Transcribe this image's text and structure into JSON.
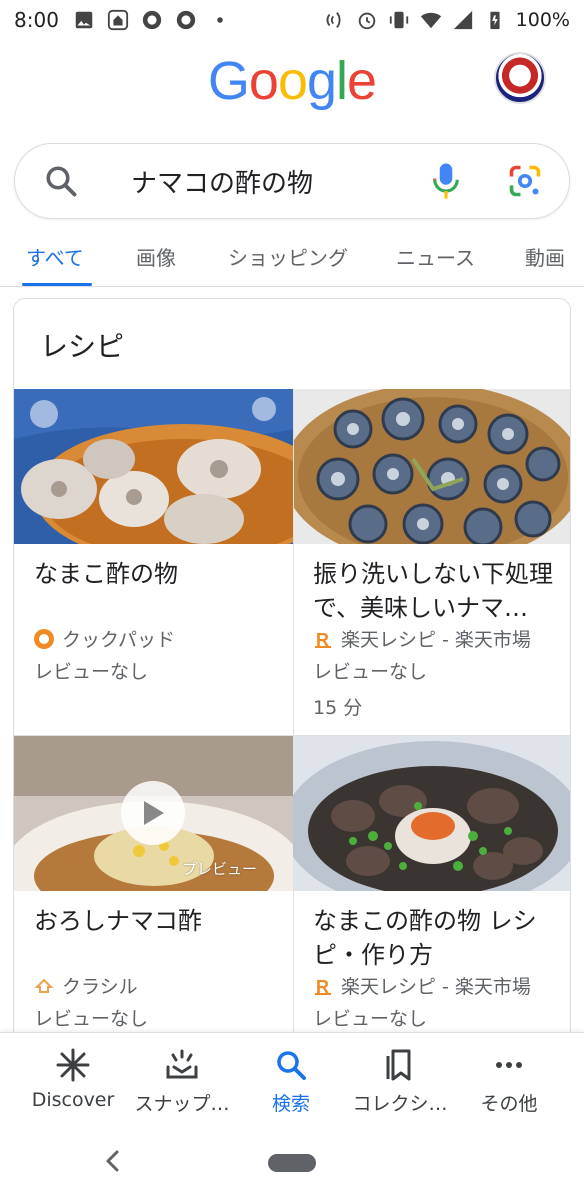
{
  "status_bar": {
    "time": "8:00",
    "battery": "100%",
    "icons": [
      "image-icon",
      "home-icon",
      "app-icon",
      "app-icon",
      "dot-icon",
      "nfc-icon",
      "alarm-icon",
      "vibrate-icon",
      "wifi-icon",
      "signal-icon",
      "battery-icon"
    ]
  },
  "header": {
    "logo_letters": [
      "G",
      "o",
      "o",
      "g",
      "l",
      "e"
    ],
    "logo_colors": [
      "#4285F4",
      "#EA4335",
      "#FBBC05",
      "#4285F4",
      "#34A853",
      "#EA4335"
    ]
  },
  "search": {
    "query": "ナマコの酢の物"
  },
  "tabs": [
    {
      "label": "すべて",
      "active": true
    },
    {
      "label": "画像",
      "active": false
    },
    {
      "label": "ショッピング",
      "active": false
    },
    {
      "label": "ニュース",
      "active": false
    },
    {
      "label": "動画",
      "active": false
    }
  ],
  "recipes": {
    "title": "レシピ",
    "items": [
      {
        "title": "なまこ酢の物",
        "source": "クックパッド",
        "review": "レビューなし",
        "time": ""
      },
      {
        "title": "振り洗いしない下処理で、美味しいナマ…",
        "source": "楽天レシピ - 楽天市場",
        "review": "レビューなし",
        "time": "15 分"
      },
      {
        "title": "おろしナマコ酢",
        "source": "クラシル",
        "review": "レビューなし",
        "time": "",
        "preview_label": "プレビュー"
      },
      {
        "title": "なまこの酢の物 レシピ・作り方",
        "source": "楽天レシピ - 楽天市場",
        "review": "レビューなし",
        "time": ""
      }
    ]
  },
  "bottom_nav": [
    {
      "label": "Discover",
      "icon": "asterisk-icon",
      "active": false
    },
    {
      "label": "スナップ…",
      "icon": "snapshot-icon",
      "active": false
    },
    {
      "label": "検索",
      "icon": "search-icon",
      "active": true
    },
    {
      "label": "コレクシ…",
      "icon": "collections-icon",
      "active": false
    },
    {
      "label": "その他",
      "icon": "more-icon",
      "active": false
    }
  ],
  "colors": {
    "accent": "#1a73e8",
    "text": "#202124",
    "secondary": "#5f6368"
  }
}
